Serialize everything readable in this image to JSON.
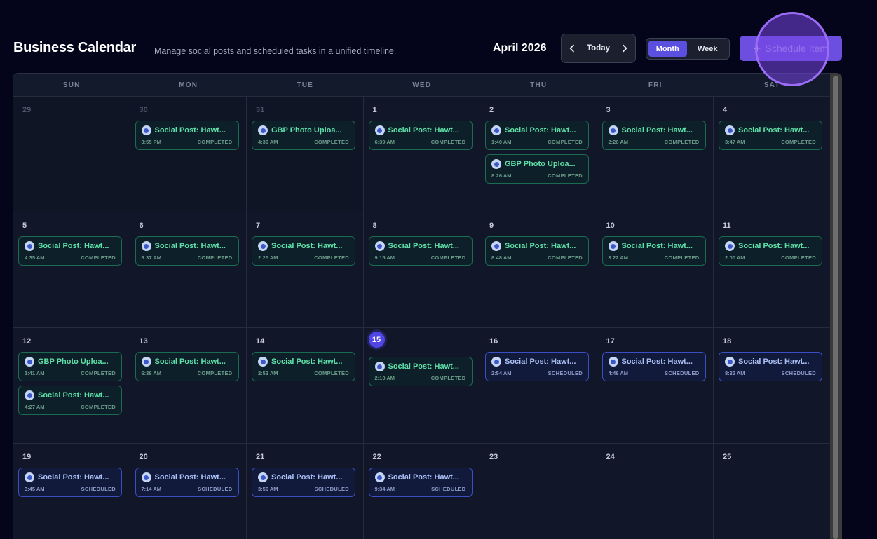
{
  "header": {
    "title": "Business Calendar",
    "subtitle": "Manage social posts and scheduled tasks in a unified timeline.",
    "month_label": "April 2026",
    "today_label": "Today",
    "view_month": "Month",
    "view_week": "Week",
    "active_view": "Month",
    "schedule_plus": "+",
    "schedule_label": "Schedule Item"
  },
  "days_of_week": [
    "SUN",
    "MON",
    "TUE",
    "WED",
    "THU",
    "FRI",
    "SAT"
  ],
  "weeks": [
    [
      {
        "day": "29",
        "muted": true,
        "events": []
      },
      {
        "day": "30",
        "muted": true,
        "events": [
          {
            "title": "Social Post: Hawt...",
            "time": "3:55 PM",
            "status": "COMPLETED"
          }
        ]
      },
      {
        "day": "31",
        "muted": true,
        "events": [
          {
            "title": "GBP Photo Uploa...",
            "time": "4:39 AM",
            "status": "COMPLETED"
          }
        ]
      },
      {
        "day": "1",
        "events": [
          {
            "title": "Social Post: Hawt...",
            "time": "6:39 AM",
            "status": "COMPLETED"
          }
        ]
      },
      {
        "day": "2",
        "events": [
          {
            "title": "Social Post: Hawt...",
            "time": "1:40 AM",
            "status": "COMPLETED"
          },
          {
            "title": "GBP Photo Uploa...",
            "time": "8:26 AM",
            "status": "COMPLETED"
          }
        ]
      },
      {
        "day": "3",
        "events": [
          {
            "title": "Social Post: Hawt...",
            "time": "2:26 AM",
            "status": "COMPLETED"
          }
        ]
      },
      {
        "day": "4",
        "events": [
          {
            "title": "Social Post: Hawt...",
            "time": "3:47 AM",
            "status": "COMPLETED"
          }
        ]
      }
    ],
    [
      {
        "day": "5",
        "events": [
          {
            "title": "Social Post: Hawt...",
            "time": "4:35 AM",
            "status": "COMPLETED"
          }
        ]
      },
      {
        "day": "6",
        "events": [
          {
            "title": "Social Post: Hawt...",
            "time": "6:37 AM",
            "status": "COMPLETED"
          }
        ]
      },
      {
        "day": "7",
        "events": [
          {
            "title": "Social Post: Hawt...",
            "time": "2:25 AM",
            "status": "COMPLETED"
          }
        ]
      },
      {
        "day": "8",
        "events": [
          {
            "title": "Social Post: Hawt...",
            "time": "9:15 AM",
            "status": "COMPLETED"
          }
        ]
      },
      {
        "day": "9",
        "events": [
          {
            "title": "Social Post: Hawt...",
            "time": "8:48 AM",
            "status": "COMPLETED"
          }
        ]
      },
      {
        "day": "10",
        "events": [
          {
            "title": "Social Post: Hawt...",
            "time": "3:22 AM",
            "status": "COMPLETED"
          }
        ]
      },
      {
        "day": "11",
        "events": [
          {
            "title": "Social Post: Hawt...",
            "time": "2:00 AM",
            "status": "COMPLETED"
          }
        ]
      }
    ],
    [
      {
        "day": "12",
        "events": [
          {
            "title": "GBP Photo Uploa...",
            "time": "1:41 AM",
            "status": "COMPLETED"
          },
          {
            "title": "Social Post: Hawt...",
            "time": "4:27 AM",
            "status": "COMPLETED"
          }
        ]
      },
      {
        "day": "13",
        "events": [
          {
            "title": "Social Post: Hawt...",
            "time": "6:38 AM",
            "status": "COMPLETED"
          }
        ]
      },
      {
        "day": "14",
        "events": [
          {
            "title": "Social Post: Hawt...",
            "time": "2:53 AM",
            "status": "COMPLETED"
          }
        ]
      },
      {
        "day": "15",
        "today": true,
        "events": [
          {
            "title": "Social Post: Hawt...",
            "time": "2:10 AM",
            "status": "COMPLETED"
          }
        ]
      },
      {
        "day": "16",
        "events": [
          {
            "title": "Social Post: Hawt...",
            "time": "2:54 AM",
            "status": "SCHEDULED"
          }
        ]
      },
      {
        "day": "17",
        "events": [
          {
            "title": "Social Post: Hawt...",
            "time": "4:46 AM",
            "status": "SCHEDULED"
          }
        ]
      },
      {
        "day": "18",
        "events": [
          {
            "title": "Social Post: Hawt...",
            "time": "8:32 AM",
            "status": "SCHEDULED"
          }
        ]
      }
    ],
    [
      {
        "day": "19",
        "events": [
          {
            "title": "Social Post: Hawt...",
            "time": "3:45 AM",
            "status": "SCHEDULED"
          }
        ]
      },
      {
        "day": "20",
        "events": [
          {
            "title": "Social Post: Hawt...",
            "time": "7:14 AM",
            "status": "SCHEDULED"
          }
        ]
      },
      {
        "day": "21",
        "events": [
          {
            "title": "Social Post: Hawt...",
            "time": "3:56 AM",
            "status": "SCHEDULED"
          }
        ]
      },
      {
        "day": "22",
        "events": [
          {
            "title": "Social Post: Hawt...",
            "time": "9:34 AM",
            "status": "SCHEDULED"
          }
        ]
      },
      {
        "day": "23",
        "events": []
      },
      {
        "day": "24",
        "events": []
      },
      {
        "day": "25",
        "events": []
      }
    ]
  ],
  "colors": {
    "background": "#04041a",
    "accent": "#5b4fe0",
    "completed": "#5fe0a8",
    "scheduled": "#aac0f5",
    "today_badge": "#4f46e5"
  },
  "icons": {
    "prev": "chevron-left-icon",
    "next": "chevron-right-icon",
    "event": "avatar-icon"
  }
}
